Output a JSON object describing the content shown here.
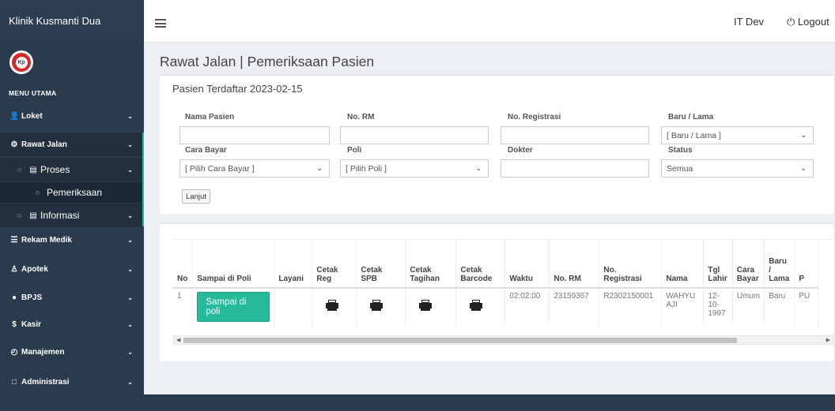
{
  "app": {
    "brand": "Klinik Kusmanti Dua",
    "logo_text": "Kp"
  },
  "sidebar": {
    "header": "MENU UTAMA",
    "items": [
      {
        "label": "Loket",
        "icon": "user-icon"
      },
      {
        "label": "Rawat Jalan",
        "icon": "gear-icon"
      },
      {
        "label": "Proses",
        "icon": "bed-icon"
      },
      {
        "label": "Pemeriksaan"
      },
      {
        "label": "Informasi",
        "icon": "list-icon"
      },
      {
        "label": "Rekam Medik",
        "icon": "list-icon"
      },
      {
        "label": "Apotek",
        "icon": "person-icon"
      },
      {
        "label": "BPJS",
        "icon": "bulb-icon"
      },
      {
        "label": "Kasir",
        "icon": "dollar-icon"
      },
      {
        "label": "Manajemen",
        "icon": "clock-icon"
      },
      {
        "label": "Administrasi",
        "icon": "square-icon"
      }
    ]
  },
  "topbar": {
    "user": "IT Dev",
    "logout": "Logout"
  },
  "page": {
    "title": "Rawat Jalan | Pemeriksaan Pasien",
    "box_title": "Pasien Terdaftar 2023-02-15"
  },
  "form": {
    "nama_pasien": {
      "label": "Nama Pasien",
      "value": ""
    },
    "no_rm": {
      "label": "No. RM",
      "value": ""
    },
    "no_registrasi": {
      "label": "No. Registrasi",
      "value": ""
    },
    "baru_lama": {
      "label": "Baru / Lama",
      "value": "[ Baru / Lama ]"
    },
    "cara_bayar": {
      "label": "Cara Bayar",
      "value": "[ Pilih Cara Bayar ]"
    },
    "poli": {
      "label": "Poli",
      "value": "[ Pilih Poli ]"
    },
    "dokter": {
      "label": "Dokter",
      "value": ""
    },
    "status": {
      "label": "Status",
      "value": "Semua"
    },
    "submit": "Lanjut"
  },
  "table": {
    "headers": [
      "No",
      "Sampai di Poli",
      "Layani",
      "Cetak Reg",
      "Cetak SPB",
      "Cetak Tagihan",
      "Cetak Barcode",
      "Waktu",
      "No. RM",
      "No. Registrasi",
      "Nama",
      "Tgl Lahir",
      "Cara Bayar",
      "Baru / Lama",
      "P"
    ],
    "row": {
      "no": "1",
      "sampai_button": "Sampai di poli",
      "waktu": "02:02:00",
      "no_rm": "23159367",
      "no_registrasi": "R2302150001",
      "nama": "WAHYU AJI",
      "tgl_lahir": "12-10-1997",
      "cara_bayar": "Umum",
      "baru_lama": "Baru",
      "poli": "PU"
    }
  }
}
